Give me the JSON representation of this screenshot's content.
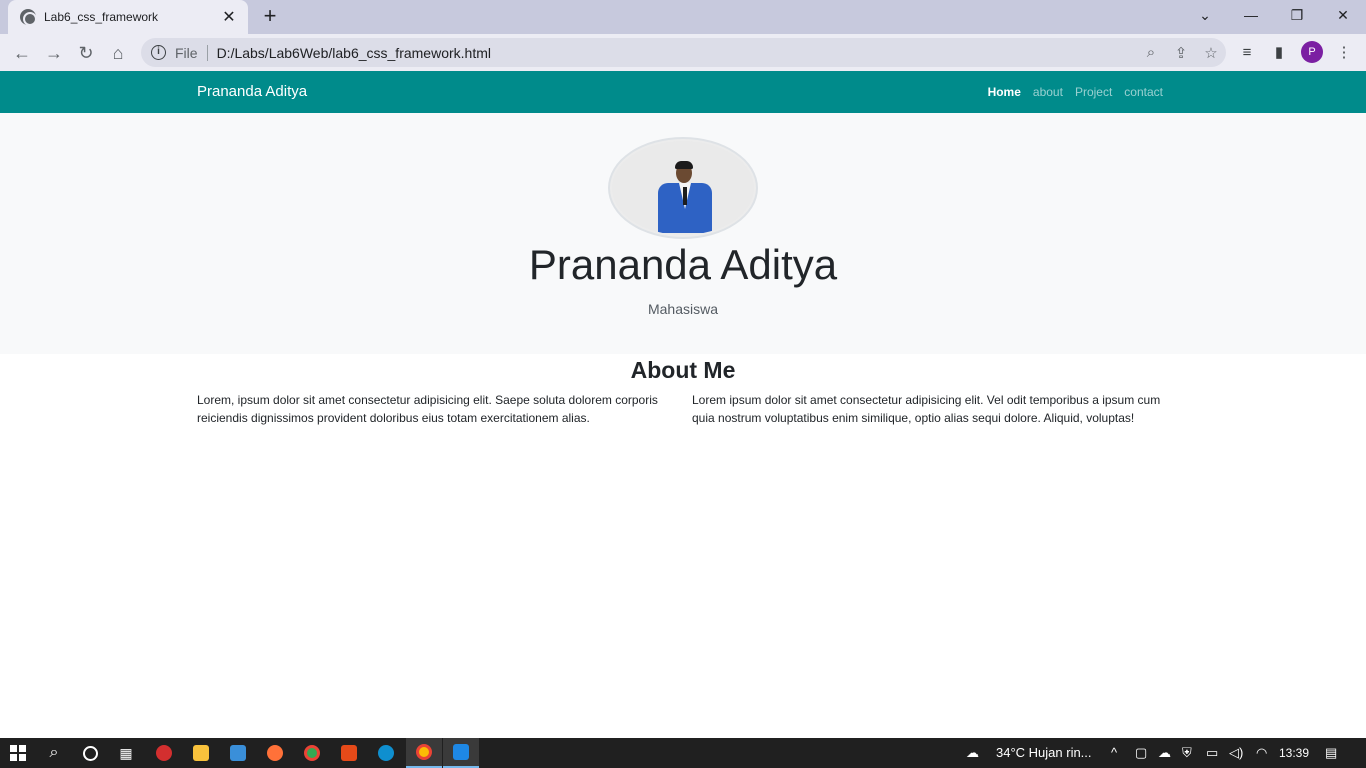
{
  "browser": {
    "tab_title": "Lab6_css_framework",
    "new_tab_icon": "+",
    "scheme_label": "File",
    "url": "D:/Labs/Lab6Web/lab6_css_framework.html",
    "profile_initial": "P"
  },
  "site": {
    "brand": "Prananda Aditya",
    "nav": [
      {
        "label": "Home",
        "active": true
      },
      {
        "label": "about",
        "active": false
      },
      {
        "label": "Project",
        "active": false
      },
      {
        "label": "contact",
        "active": false
      }
    ],
    "hero_name": "Prananda Aditya",
    "hero_role": "Mahasiswa",
    "about_title": "About Me",
    "about_col_1": "Lorem, ipsum dolor sit amet consectetur adipisicing elit. Saepe soluta dolorem corporis reiciendis dignissimos provident doloribus eius totam exercitationem alias.",
    "about_col_2": "Lorem ipsum dolor sit amet consectetur adipisicing elit. Vel odit temporibus a ipsum cum quia nostrum voluptatibus enim similique, optio alias sequi dolore. Aliquid, voluptas!"
  },
  "taskbar": {
    "weather": "34°C  Hujan rin...",
    "time": "13:39"
  },
  "colors": {
    "navbar": "#008b8b",
    "hero_bg": "#f8f9fa"
  }
}
